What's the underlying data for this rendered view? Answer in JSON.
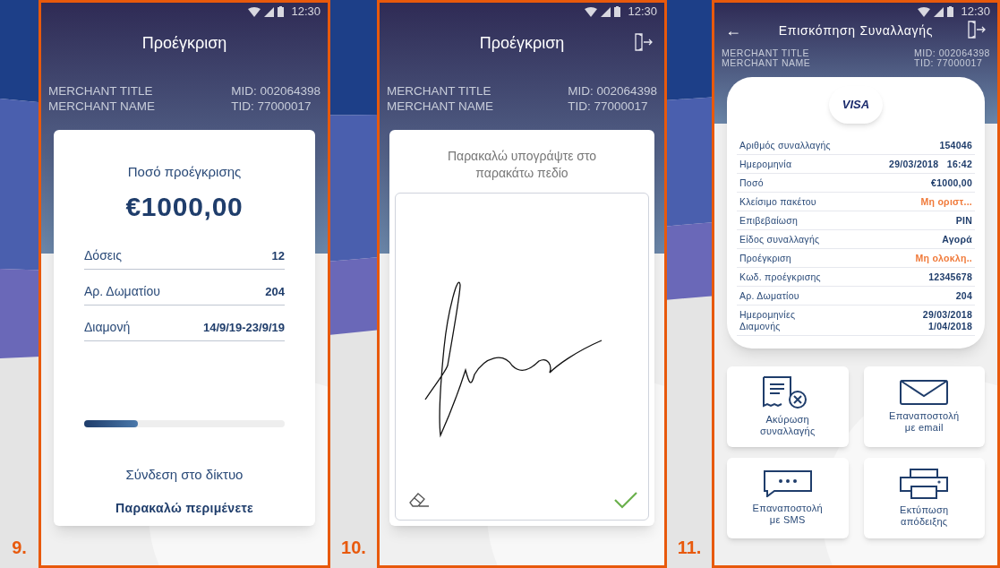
{
  "screens": [
    {
      "kind": "preauth",
      "number": "9.",
      "time": "12:30",
      "title": "Προέγκριση",
      "exit": false,
      "merchant": {
        "title": "MERCHANT TITLE",
        "name": "MERCHANT NAME",
        "mid": "MID: 002064398",
        "tid": "TID: 77000017"
      },
      "amount_label": "Ποσό προέγκρισης",
      "amount": "€1000,00",
      "rows": [
        {
          "label": "Δόσεις",
          "value": "12"
        },
        {
          "label": "Αρ. Δωματίου",
          "value": "204"
        },
        {
          "label": "Διαμονή",
          "value": "14/9/19-23/9/19"
        }
      ],
      "level": 0.27,
      "status": "Σύνδεση στο δίκτυο",
      "wait": "Παρακαλώ περιμένετε"
    },
    {
      "kind": "signature",
      "number": "10.",
      "time": "12:30",
      "title": "Προέγκριση",
      "exit": true,
      "merchant": {
        "title": "MERCHANT TITLE",
        "name": "MERCHANT NAME",
        "mid": "MID: 002064398",
        "tid": "TID: 77000017"
      },
      "prompt": "Παρακαλώ υπογράψτε στο παρακάτω πεδίο"
    },
    {
      "kind": "review",
      "number": "11.",
      "time": "12:30",
      "title": "Επισκόπηση Συναλλαγής",
      "back_arrow": "←",
      "exit": true,
      "merchant": {
        "title": "MERCHANT TITLE",
        "name": "MERCHANT NAME",
        "mid": "MID: 002064398",
        "tid": "TID: 77000017"
      },
      "card_brand": "VISA",
      "rows": [
        {
          "label": [
            "Αριθμός συναλλαγής"
          ],
          "value": [
            "154046"
          ],
          "alert": false
        },
        {
          "label": [
            "Ημερομηνία"
          ],
          "value": [
            "29/03/2018   16:42"
          ],
          "alert": false
        },
        {
          "label": [
            "Ποσό"
          ],
          "value": [
            "€1000,00"
          ],
          "alert": false
        },
        {
          "label": [
            "Κλείσιμο πακέτου"
          ],
          "value": [
            "Μη οριστ..."
          ],
          "alert": true
        },
        {
          "label": [
            "Επιβεβαίωση"
          ],
          "value": [
            "PIN"
          ],
          "alert": false
        },
        {
          "label": [
            "Είδος συναλλαγής"
          ],
          "value": [
            "Αγορά"
          ],
          "alert": false
        },
        {
          "label": [
            "Προέγκριση"
          ],
          "value": [
            "Μη ολοκλη.."
          ],
          "alert": true
        },
        {
          "label": [
            "Κωδ. προέγκρισης"
          ],
          "value": [
            "12345678"
          ],
          "alert": false
        },
        {
          "label": [
            "Αρ. Δωματίου"
          ],
          "value": [
            "204"
          ],
          "alert": false
        },
        {
          "label": [
            "Ημερομηνίες",
            "Διαμονής"
          ],
          "value": [
            "29/03/2018",
            "1/04/2018"
          ],
          "alert": false
        }
      ],
      "actions": [
        {
          "kind": "cancel",
          "label": [
            "Ακύρωση",
            "συναλλαγής"
          ]
        },
        {
          "kind": "email",
          "label": [
            "Επαναποστολή",
            "με email"
          ]
        },
        {
          "kind": "sms",
          "label": [
            "Επαναποστολή",
            "με SMS"
          ]
        },
        {
          "kind": "print",
          "label": [
            "Εκτύπωση",
            "απόδειξης"
          ]
        }
      ]
    }
  ]
}
